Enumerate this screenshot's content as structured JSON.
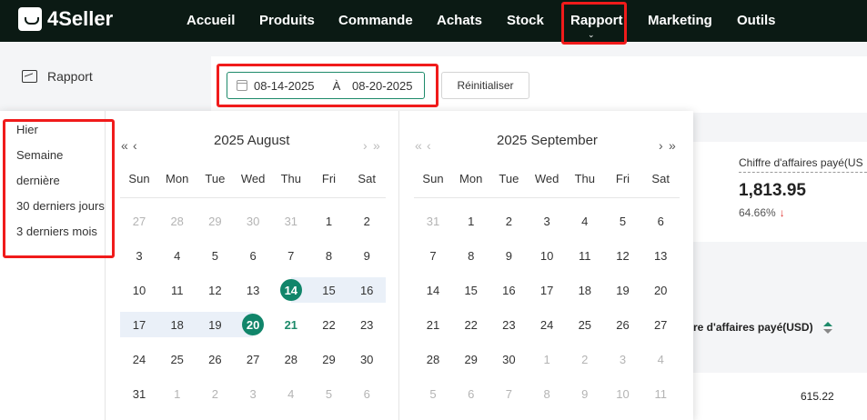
{
  "header": {
    "logo": "4Seller",
    "nav": [
      {
        "label": "Accueil"
      },
      {
        "label": "Produits"
      },
      {
        "label": "Commande"
      },
      {
        "label": "Achats"
      },
      {
        "label": "Stock"
      },
      {
        "label": "Rapport"
      },
      {
        "label": "Marketing"
      },
      {
        "label": "Outils"
      }
    ],
    "active": "Rapport"
  },
  "sidebar": {
    "title": "Rapport"
  },
  "filter": {
    "start_date": "08-14-2025",
    "separator": "À",
    "end_date": "08-20-2025",
    "reset_label": "Réinitialiser"
  },
  "presets": [
    "Hier",
    "Semaine",
    "dernière",
    "30 derniers jours",
    "3 derniers mois"
  ],
  "calendar": {
    "weekdays": [
      "Sun",
      "Mon",
      "Tue",
      "Wed",
      "Thu",
      "Fri",
      "Sat"
    ],
    "months": [
      {
        "title": "2025 August",
        "prev_enabled": true,
        "next_enabled": false,
        "weeks": [
          [
            "27",
            "28",
            "29",
            "30",
            "31",
            "1",
            "2"
          ],
          [
            "3",
            "4",
            "5",
            "6",
            "7",
            "8",
            "9"
          ],
          [
            "10",
            "11",
            "12",
            "13",
            "14",
            "15",
            "16"
          ],
          [
            "17",
            "18",
            "19",
            "20",
            "21",
            "22",
            "23"
          ],
          [
            "24",
            "25",
            "26",
            "27",
            "28",
            "29",
            "30"
          ],
          [
            "31",
            "1",
            "2",
            "3",
            "4",
            "5",
            "6"
          ]
        ],
        "first_in_month": 5,
        "last_in_month": 35
      },
      {
        "title": "2025 September",
        "prev_enabled": false,
        "next_enabled": true,
        "weeks": [
          [
            "31",
            "1",
            "2",
            "3",
            "4",
            "5",
            "6"
          ],
          [
            "7",
            "8",
            "9",
            "10",
            "11",
            "12",
            "13"
          ],
          [
            "14",
            "15",
            "16",
            "17",
            "18",
            "19",
            "20"
          ],
          [
            "21",
            "22",
            "23",
            "24",
            "25",
            "26",
            "27"
          ],
          [
            "28",
            "29",
            "30",
            "1",
            "2",
            "3",
            "4"
          ],
          [
            "5",
            "6",
            "7",
            "8",
            "9",
            "10",
            "11"
          ]
        ],
        "first_in_month": 1,
        "last_in_month": 30
      }
    ],
    "selected_start": "14",
    "selected_end": "20",
    "today": "21",
    "accent_color": "#11856a"
  },
  "summary_card": {
    "label": "Chiffre d'affaires payé(US",
    "value": "1,813.95",
    "change": "64.66%",
    "trend": "down"
  },
  "table": {
    "column_header": "re d'affaires payé(USD)",
    "row_value": "615.22"
  }
}
